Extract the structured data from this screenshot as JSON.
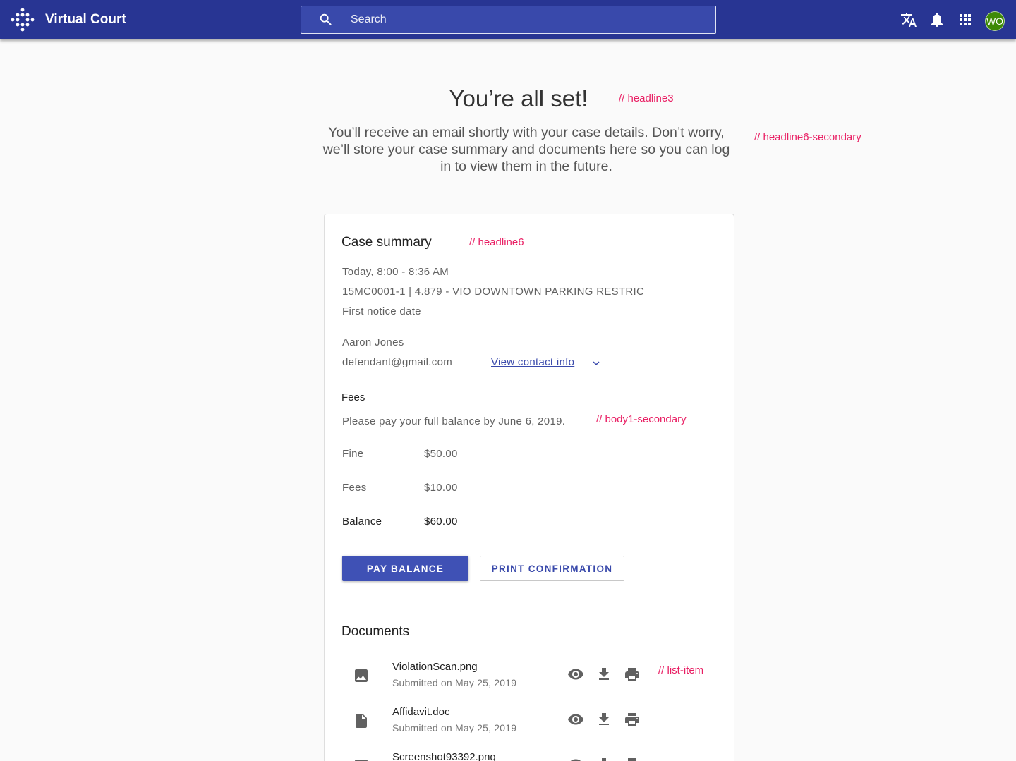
{
  "appbar": {
    "title": "Virtual Court",
    "search_placeholder": "Search",
    "avatar_initials": "WO",
    "color": "#283593"
  },
  "page": {
    "headline": "You’re all set!",
    "subtext": "You’ll receive an email shortly with your case details. Don’t worry,  we’ll store your case summary and documents here so you can log in to view them in the future."
  },
  "annotations": {
    "headline": "// headline3",
    "subtext": "// headline6-secondary",
    "card_title": "// headline6",
    "body1": "// body1-secondary",
    "list_item": "// list-item"
  },
  "card": {
    "title": "Case summary",
    "time": "Today, 8:00 - 8:36 AM",
    "case": "15MC0001-1 | 4.879 - VIO DOWNTOWN PARKING RESTRIC",
    "notice": "First notice date",
    "name": "Aaron Jones",
    "email": "defendant@gmail.com",
    "contact_link": "View contact info",
    "fees_title": "Fees",
    "fees_note": "Please pay your full balance by June 6, 2019.",
    "fees": [
      {
        "label": "Fine",
        "value": "$50.00"
      },
      {
        "label": "Fees",
        "value": "$10.00"
      },
      {
        "label": "Balance",
        "value": "$60.00"
      }
    ],
    "pay_button": "PAY BALANCE",
    "print_button": "PRINT CONFIRMATION",
    "accent": "#3f51b5"
  },
  "documents": {
    "title": "Documents",
    "items": [
      {
        "name": "ViolationScan.png",
        "date": "Submitted on May 25, 2019",
        "icon": "image-icon"
      },
      {
        "name": "Affidavit.doc",
        "date": "Submitted on May 25, 2019",
        "icon": "file-icon"
      },
      {
        "name": "Screenshot93392.png",
        "date": "",
        "icon": "image-icon"
      }
    ]
  }
}
